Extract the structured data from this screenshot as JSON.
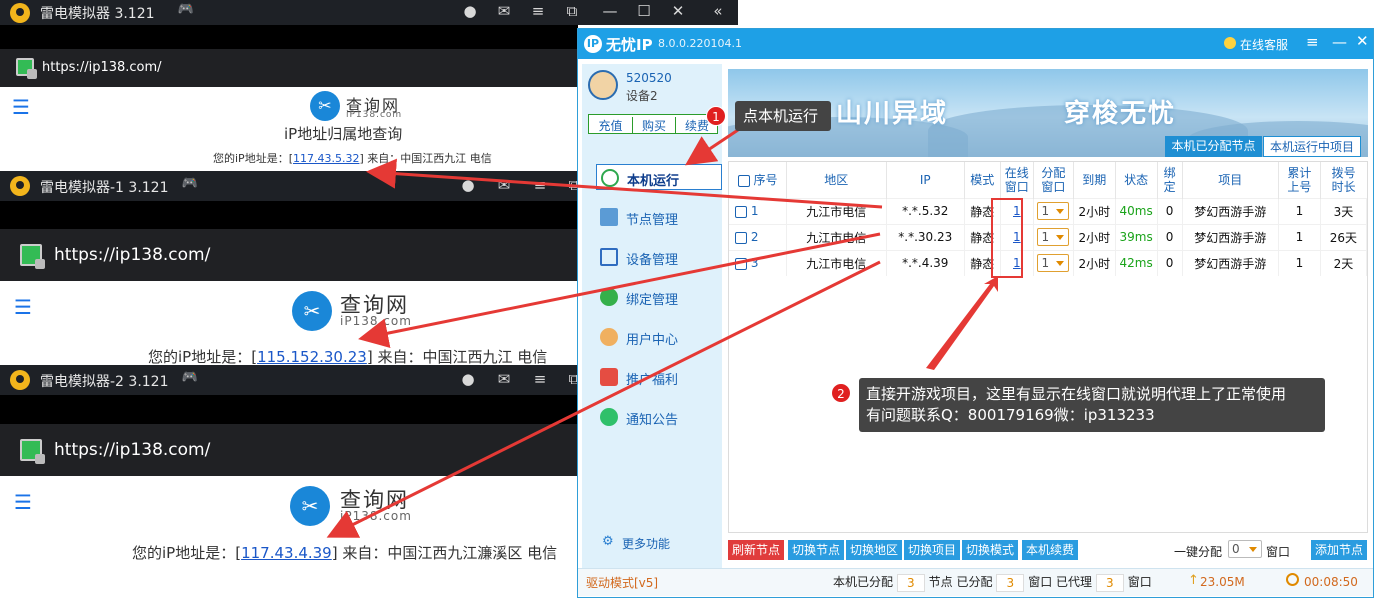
{
  "emulator_main": {
    "title": "雷电模拟器 3.121",
    "url": "https://ip138.com/",
    "logo_text": "查询网",
    "logo_sub": "iP138.com",
    "heading": "iP地址归属地查询",
    "ip_prefix": "您的iP地址是：[",
    "ip": "117.43.5.32",
    "ip_suffix": "] 来自：中国江西九江 电信"
  },
  "emulator_1": {
    "title": "雷电模拟器-1 3.121",
    "url": "https://ip138.com/",
    "logo_text": "查询网",
    "logo_sub": "iP138.com",
    "ip_prefix": "您的iP地址是：[",
    "ip": "115.152.30.23",
    "ip_suffix": "] 来自：中国江西九江 电信"
  },
  "emulator_2": {
    "title": "雷电模拟器-2 3.121",
    "url": "https://ip138.com/",
    "logo_text": "查询网",
    "logo_sub": "iP138.com",
    "ip_prefix": "您的iP地址是：[",
    "ip": "117.43.4.39",
    "ip_suffix": "] 来自：中国江西九江濂溪区 电信"
  },
  "app": {
    "title": "无忧IP",
    "version": "8.0.0.220104.1",
    "service_label": "在线客服",
    "user": {
      "id": "520520",
      "device": "设备2"
    },
    "user_buttons": [
      "充值",
      "购买",
      "续费"
    ],
    "nav": [
      {
        "label": "本机运行",
        "active": true,
        "icon": "play-icon"
      },
      {
        "label": "节点管理",
        "icon": "node-tree-icon"
      },
      {
        "label": "设备管理",
        "icon": "device-icon"
      },
      {
        "label": "绑定管理",
        "icon": "bind-icon"
      },
      {
        "label": "用户中心",
        "icon": "user-icon"
      },
      {
        "label": "推广福利",
        "icon": "gift-icon"
      },
      {
        "label": "通知公告",
        "icon": "bell-icon"
      }
    ],
    "more_label": "更多功能",
    "banner": {
      "text1": "山川异域",
      "text2": "穿梭无忧"
    },
    "tabs": [
      "本机已分配节点",
      "本机运行中项目"
    ],
    "columns": [
      "序号",
      "地区",
      "IP",
      "模式",
      "在线窗口",
      "分配窗口",
      "到期",
      "状态",
      "绑定",
      "项目",
      "累计上号",
      "拨号时长"
    ],
    "rows": [
      {
        "no": "1",
        "region": "九江市电信",
        "ip": "*.*.5.32",
        "mode": "静态",
        "online": "1",
        "assign": "1",
        "expire": "2小时",
        "status": "40ms",
        "bind": "0",
        "project": "梦幻西游手游",
        "total": "1",
        "duration": "3天"
      },
      {
        "no": "2",
        "region": "九江市电信",
        "ip": "*.*.30.23",
        "mode": "静态",
        "online": "1",
        "assign": "1",
        "expire": "2小时",
        "status": "39ms",
        "bind": "0",
        "project": "梦幻西游手游",
        "total": "1",
        "duration": "26天"
      },
      {
        "no": "3",
        "region": "九江市电信",
        "ip": "*.*.4.39",
        "mode": "静态",
        "online": "1",
        "assign": "1",
        "expire": "2小时",
        "status": "42ms",
        "bind": "0",
        "project": "梦幻西游手游",
        "total": "1",
        "duration": "2天"
      }
    ],
    "action_buttons": [
      "刷新节点",
      "切换节点",
      "切换地区",
      "切换项目",
      "切换模式",
      "本机续费"
    ],
    "one_key_label": "一键分配",
    "one_key_value": "0",
    "window_label": "窗口",
    "add_node_label": "添加节点",
    "status_bar": {
      "mode": "驱动模式[v5]",
      "allocated_label": "本机已分配",
      "allocated": "3",
      "node_label": "节点",
      "assigned_label": "已分配",
      "assigned": "3",
      "window_label": "窗口",
      "proxied_label": "已代理",
      "proxied": "3",
      "window_label2": "窗口",
      "traffic": "23.05M",
      "time": "00:08:50"
    }
  },
  "callouts": {
    "one": {
      "badge": "1",
      "text": "点本机运行"
    },
    "two": {
      "badge": "2",
      "line1": "直接开游戏项目，这里有显示在线窗口就说明代理上了正常使用",
      "line2": "有问题联系Q：800179169微：ip313233"
    }
  },
  "colors": {
    "accent": "#1ea0e6",
    "sidebar": "#dff1fb",
    "arrow": "#e53935",
    "status_ok": "#1aa31a",
    "refresh": "#e03c3c"
  }
}
